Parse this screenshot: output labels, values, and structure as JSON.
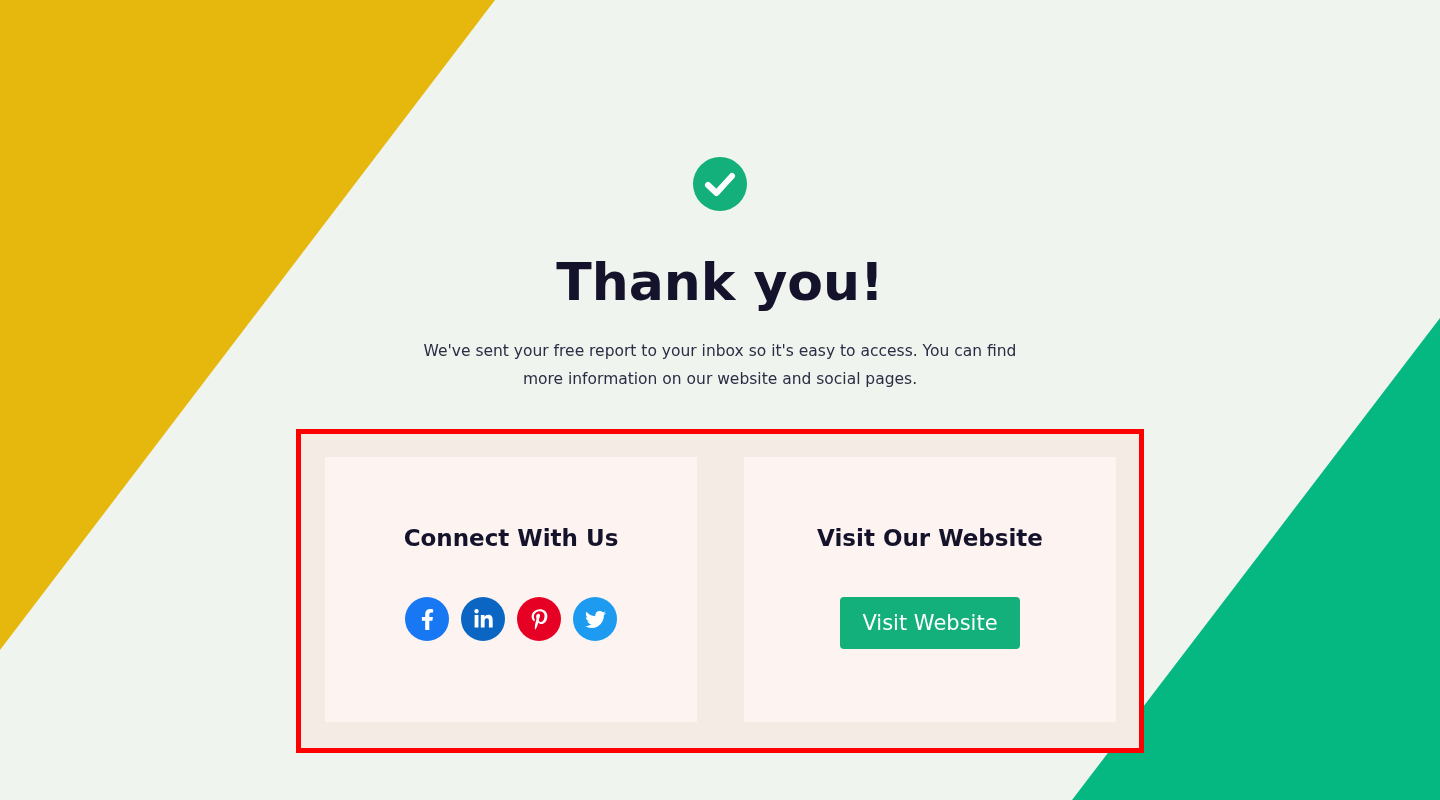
{
  "heading": "Thank you!",
  "message": "We've sent your free report to your inbox so it's easy to access. You can find more information on our website and social pages.",
  "panel": {
    "highlighted": true,
    "connect": {
      "title": "Connect With Us",
      "social": [
        {
          "kind": "facebook",
          "color": "#1877f2"
        },
        {
          "kind": "linkedin",
          "color": "#0a66c2"
        },
        {
          "kind": "pinterest",
          "color": "#e60023"
        },
        {
          "kind": "twitter",
          "color": "#1d9bf0"
        }
      ]
    },
    "website": {
      "title": "Visit Our Website",
      "button": "Visit Website"
    }
  }
}
